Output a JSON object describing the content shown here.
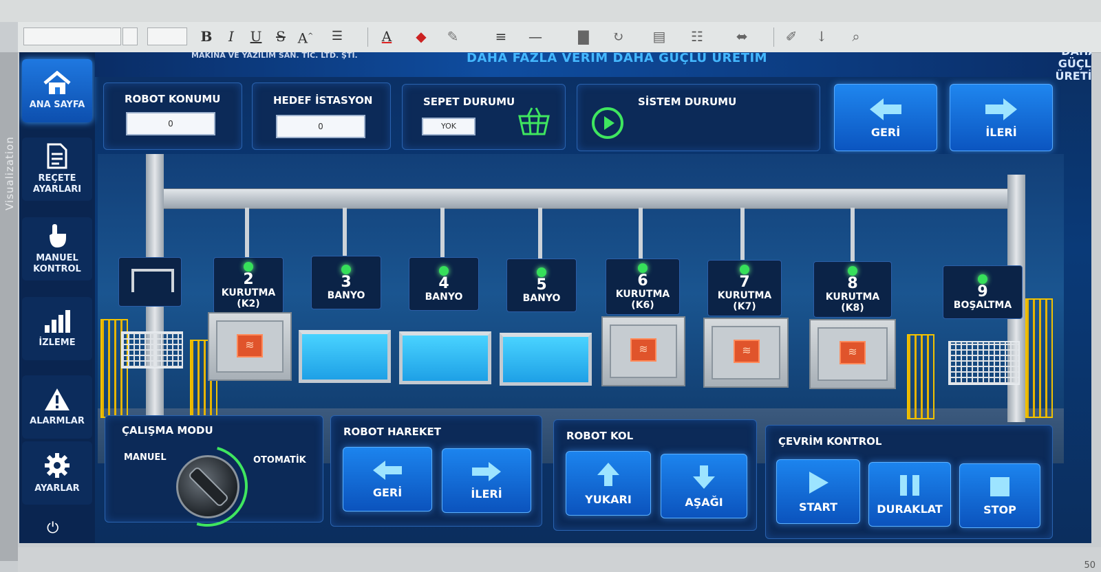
{
  "editor": {
    "side_label": "Visualization",
    "page_number": "50",
    "toolbar_glyphs": [
      "B",
      "I",
      "U",
      "S",
      "A"
    ]
  },
  "header": {
    "company": "MAKİNA VE YAZILIM SAN. TİC. LTD. ŞTİ.",
    "slogan": "DAHA FAZLA VERİM  DAHA GÜÇLÜ ÜRETİM",
    "corner_top": "DAHA GÜÇLÜ",
    "corner_bottom": "ÜRETİM"
  },
  "sidebar": {
    "items": [
      {
        "label": "ANA SAYFA",
        "icon": "home-icon"
      },
      {
        "label": "REÇETE AYARLARI",
        "icon": "document-icon"
      },
      {
        "label": "MANUEL KONTROL",
        "icon": "hand-icon"
      },
      {
        "label": "İZLEME",
        "icon": "bar-chart-icon"
      },
      {
        "label": "ALARMLAR",
        "icon": "warning-icon"
      },
      {
        "label": "AYARLAR",
        "icon": "gear-icon"
      }
    ]
  },
  "status": {
    "robot_konumu_label": "ROBOT KONUMU",
    "robot_konumu_value": "0",
    "hedef_istasyon_label": "HEDEF İSTASYON",
    "hedef_istasyon_value": "0",
    "sepet_durumu_label": "SEPET DURUMU",
    "sepet_durumu_value": "YOK",
    "sistem_durumu_label": "SİSTEM DURUMU",
    "geri_label": "GERİ",
    "ileri_label": "İLERİ"
  },
  "stations": [
    {
      "num": "2",
      "name": "KURUTMA",
      "sub": "(K2)"
    },
    {
      "num": "3",
      "name": "BANYO",
      "sub": ""
    },
    {
      "num": "4",
      "name": "BANYO",
      "sub": ""
    },
    {
      "num": "5",
      "name": "BANYO",
      "sub": ""
    },
    {
      "num": "6",
      "name": "KURUTMA",
      "sub": "(K6)"
    },
    {
      "num": "7",
      "name": "KURUTMA",
      "sub": "(K7)"
    },
    {
      "num": "8",
      "name": "KURUTMA",
      "sub": "(K8)"
    },
    {
      "num": "9",
      "name": "BOŞALTMA",
      "sub": ""
    }
  ],
  "calisma_modu": {
    "title": "ÇALIŞMA MODU",
    "manuel": "MANUEL",
    "otomatik": "OTOMATİK",
    "selected": "OTOMATİK"
  },
  "robot_hareket": {
    "title": "ROBOT HAREKET",
    "geri": "GERİ",
    "ileri": "İLERİ"
  },
  "robot_kol": {
    "title": "ROBOT KOL",
    "yukari": "YUKARI",
    "asagi": "AŞAĞI"
  },
  "cevrim_kontrol": {
    "title": "ÇEVRİM KONTROL",
    "start": "START",
    "duraklat": "DURAKLAT",
    "stop": "STOP"
  },
  "colors": {
    "accent": "#1f86ef",
    "status_ok": "#36e05a",
    "heater": "#e0542b",
    "water": "#49d3ff"
  }
}
